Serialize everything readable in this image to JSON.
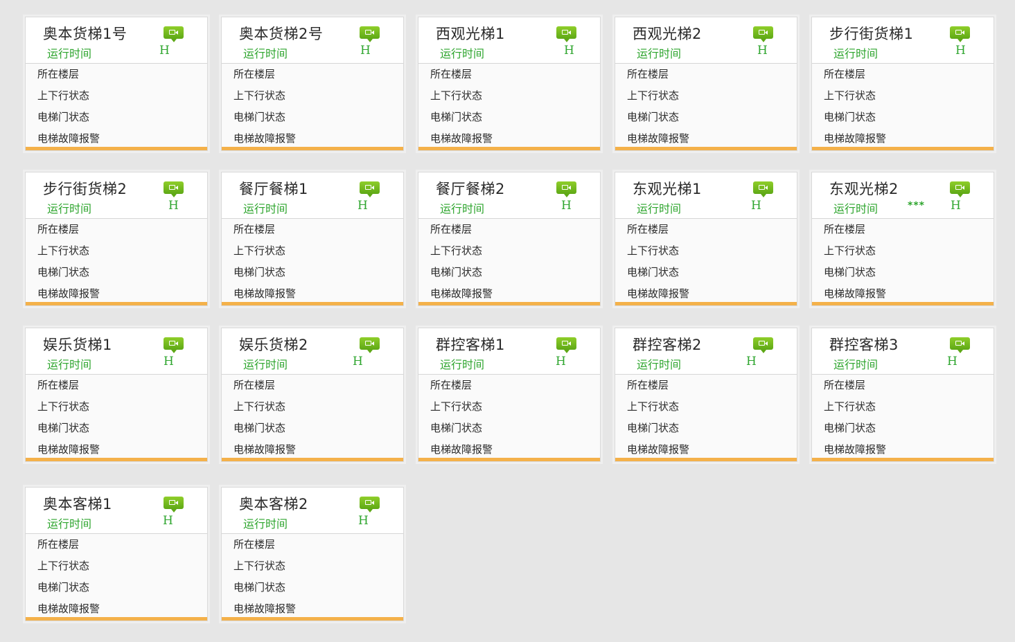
{
  "row_labels": {
    "floor": "所在楼层",
    "direction": "上下行状态",
    "door": "电梯门状态",
    "fault": "电梯故障报警"
  },
  "elevators": [
    {
      "name": "奥本货梯1号",
      "subtitle": "运行时间",
      "h": "H"
    },
    {
      "name": "奥本货梯2号",
      "subtitle": "运行时间",
      "h": "H"
    },
    {
      "name": "西观光梯1",
      "subtitle": "运行时间",
      "h": "H"
    },
    {
      "name": "西观光梯2",
      "subtitle": "运行时间",
      "h": "H"
    },
    {
      "name": "步行街货梯1",
      "subtitle": "运行时间",
      "h": "H"
    },
    {
      "name": "步行街货梯2",
      "subtitle": "运行时间",
      "h": "H"
    },
    {
      "name": "餐厅餐梯1",
      "subtitle": "运行时间",
      "h": "H"
    },
    {
      "name": "餐厅餐梯2",
      "subtitle": "运行时间",
      "h": "H"
    },
    {
      "name": "东观光梯1",
      "subtitle": "运行时间",
      "h": "H"
    },
    {
      "name": "东观光梯2",
      "subtitle": "运行时间",
      "h": "H",
      "stars": "***"
    },
    {
      "name": "娱乐货梯1",
      "subtitle": "运行时间",
      "h": "H"
    },
    {
      "name": "娱乐货梯2",
      "subtitle": "运行时间",
      "h": "H"
    },
    {
      "name": "群控客梯1",
      "subtitle": "运行时间",
      "h": "H"
    },
    {
      "name": "群控客梯2",
      "subtitle": "运行时间",
      "h": "H"
    },
    {
      "name": "群控客梯3",
      "subtitle": "运行时间",
      "h": "H"
    },
    {
      "name": "奥本客梯1",
      "subtitle": "运行时间",
      "h": "H"
    },
    {
      "name": "奥本客梯2",
      "subtitle": "运行时间",
      "h": "H"
    }
  ],
  "colors": {
    "accent_green": "#2ea52e",
    "icon_green": "#6cb81e",
    "bar_orange": "#f4b14a",
    "page_background": "#e6e6e6"
  },
  "icons": {
    "monitor": "video-camera-icon"
  }
}
